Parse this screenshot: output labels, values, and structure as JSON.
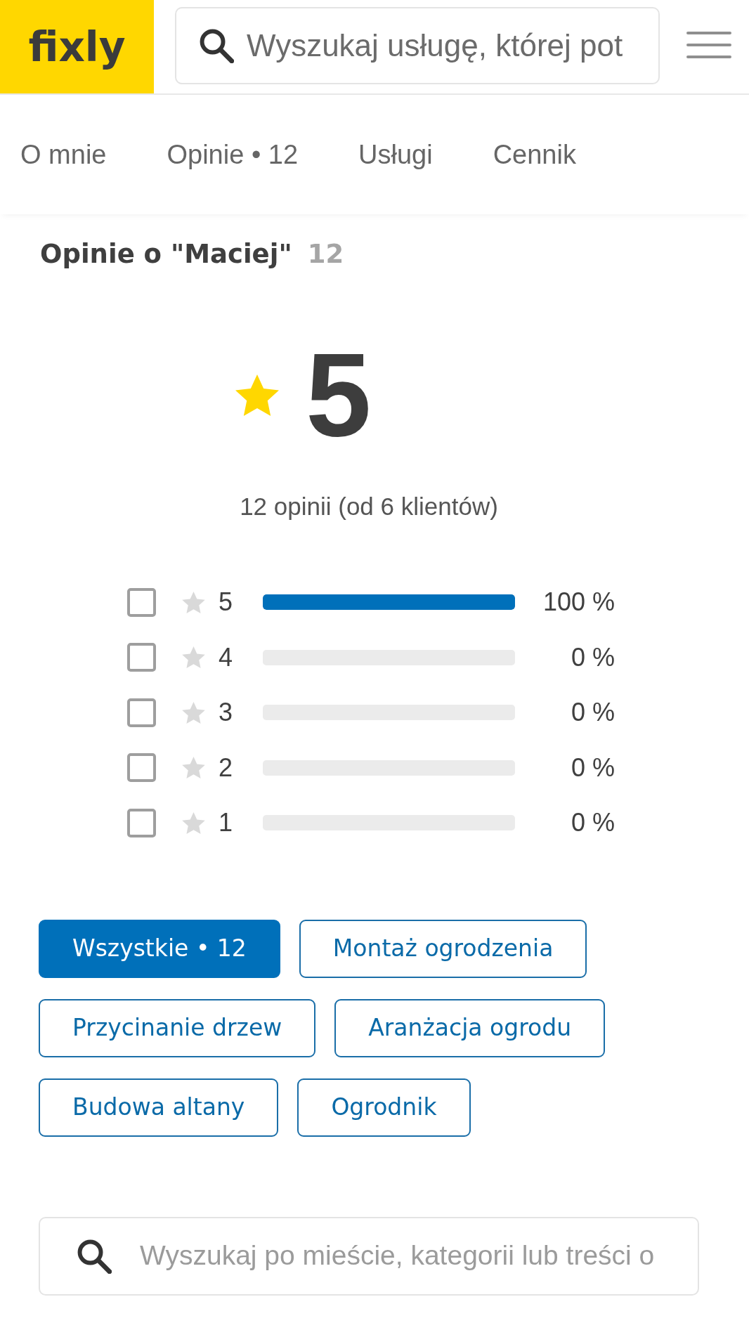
{
  "header": {
    "logo": "fixly",
    "search": {
      "placeholder": "Wyszukaj usługę, której pot"
    }
  },
  "tabs": [
    {
      "label": "O mnie"
    },
    {
      "label": "Opinie • 12"
    },
    {
      "label": "Usługi"
    },
    {
      "label": "Cennik"
    }
  ],
  "reviews": {
    "title": "Opinie o \"Maciej\"",
    "count": "12",
    "rating": "5",
    "summary": "12 opinii (od 6 klientów)",
    "breakdown": [
      {
        "label": "5",
        "checked": false,
        "level": 1,
        "reading": "100 %"
      },
      {
        "label": "4",
        "checked": false,
        "level": 0,
        "reading": "0 %"
      },
      {
        "label": "3",
        "checked": false,
        "level": 0,
        "reading": "0 %"
      },
      {
        "label": "2",
        "checked": false,
        "level": 0,
        "reading": "0 %"
      },
      {
        "label": "1",
        "checked": false,
        "level": 0,
        "reading": "0 %"
      }
    ],
    "filters": [
      {
        "label": "Wszystkie • 12",
        "selected": true
      },
      {
        "label": "Montaż ogrodzenia",
        "selected": false
      },
      {
        "label": "Przycinanie drzew",
        "selected": false
      },
      {
        "label": "Aranżacja ogrodu",
        "selected": false
      },
      {
        "label": "Budowa altany",
        "selected": false
      },
      {
        "label": "Ogrodnik",
        "selected": false
      }
    ],
    "search": {
      "placeholder": "Wyszukaj po mieście, kategorii lub treści o"
    }
  }
}
